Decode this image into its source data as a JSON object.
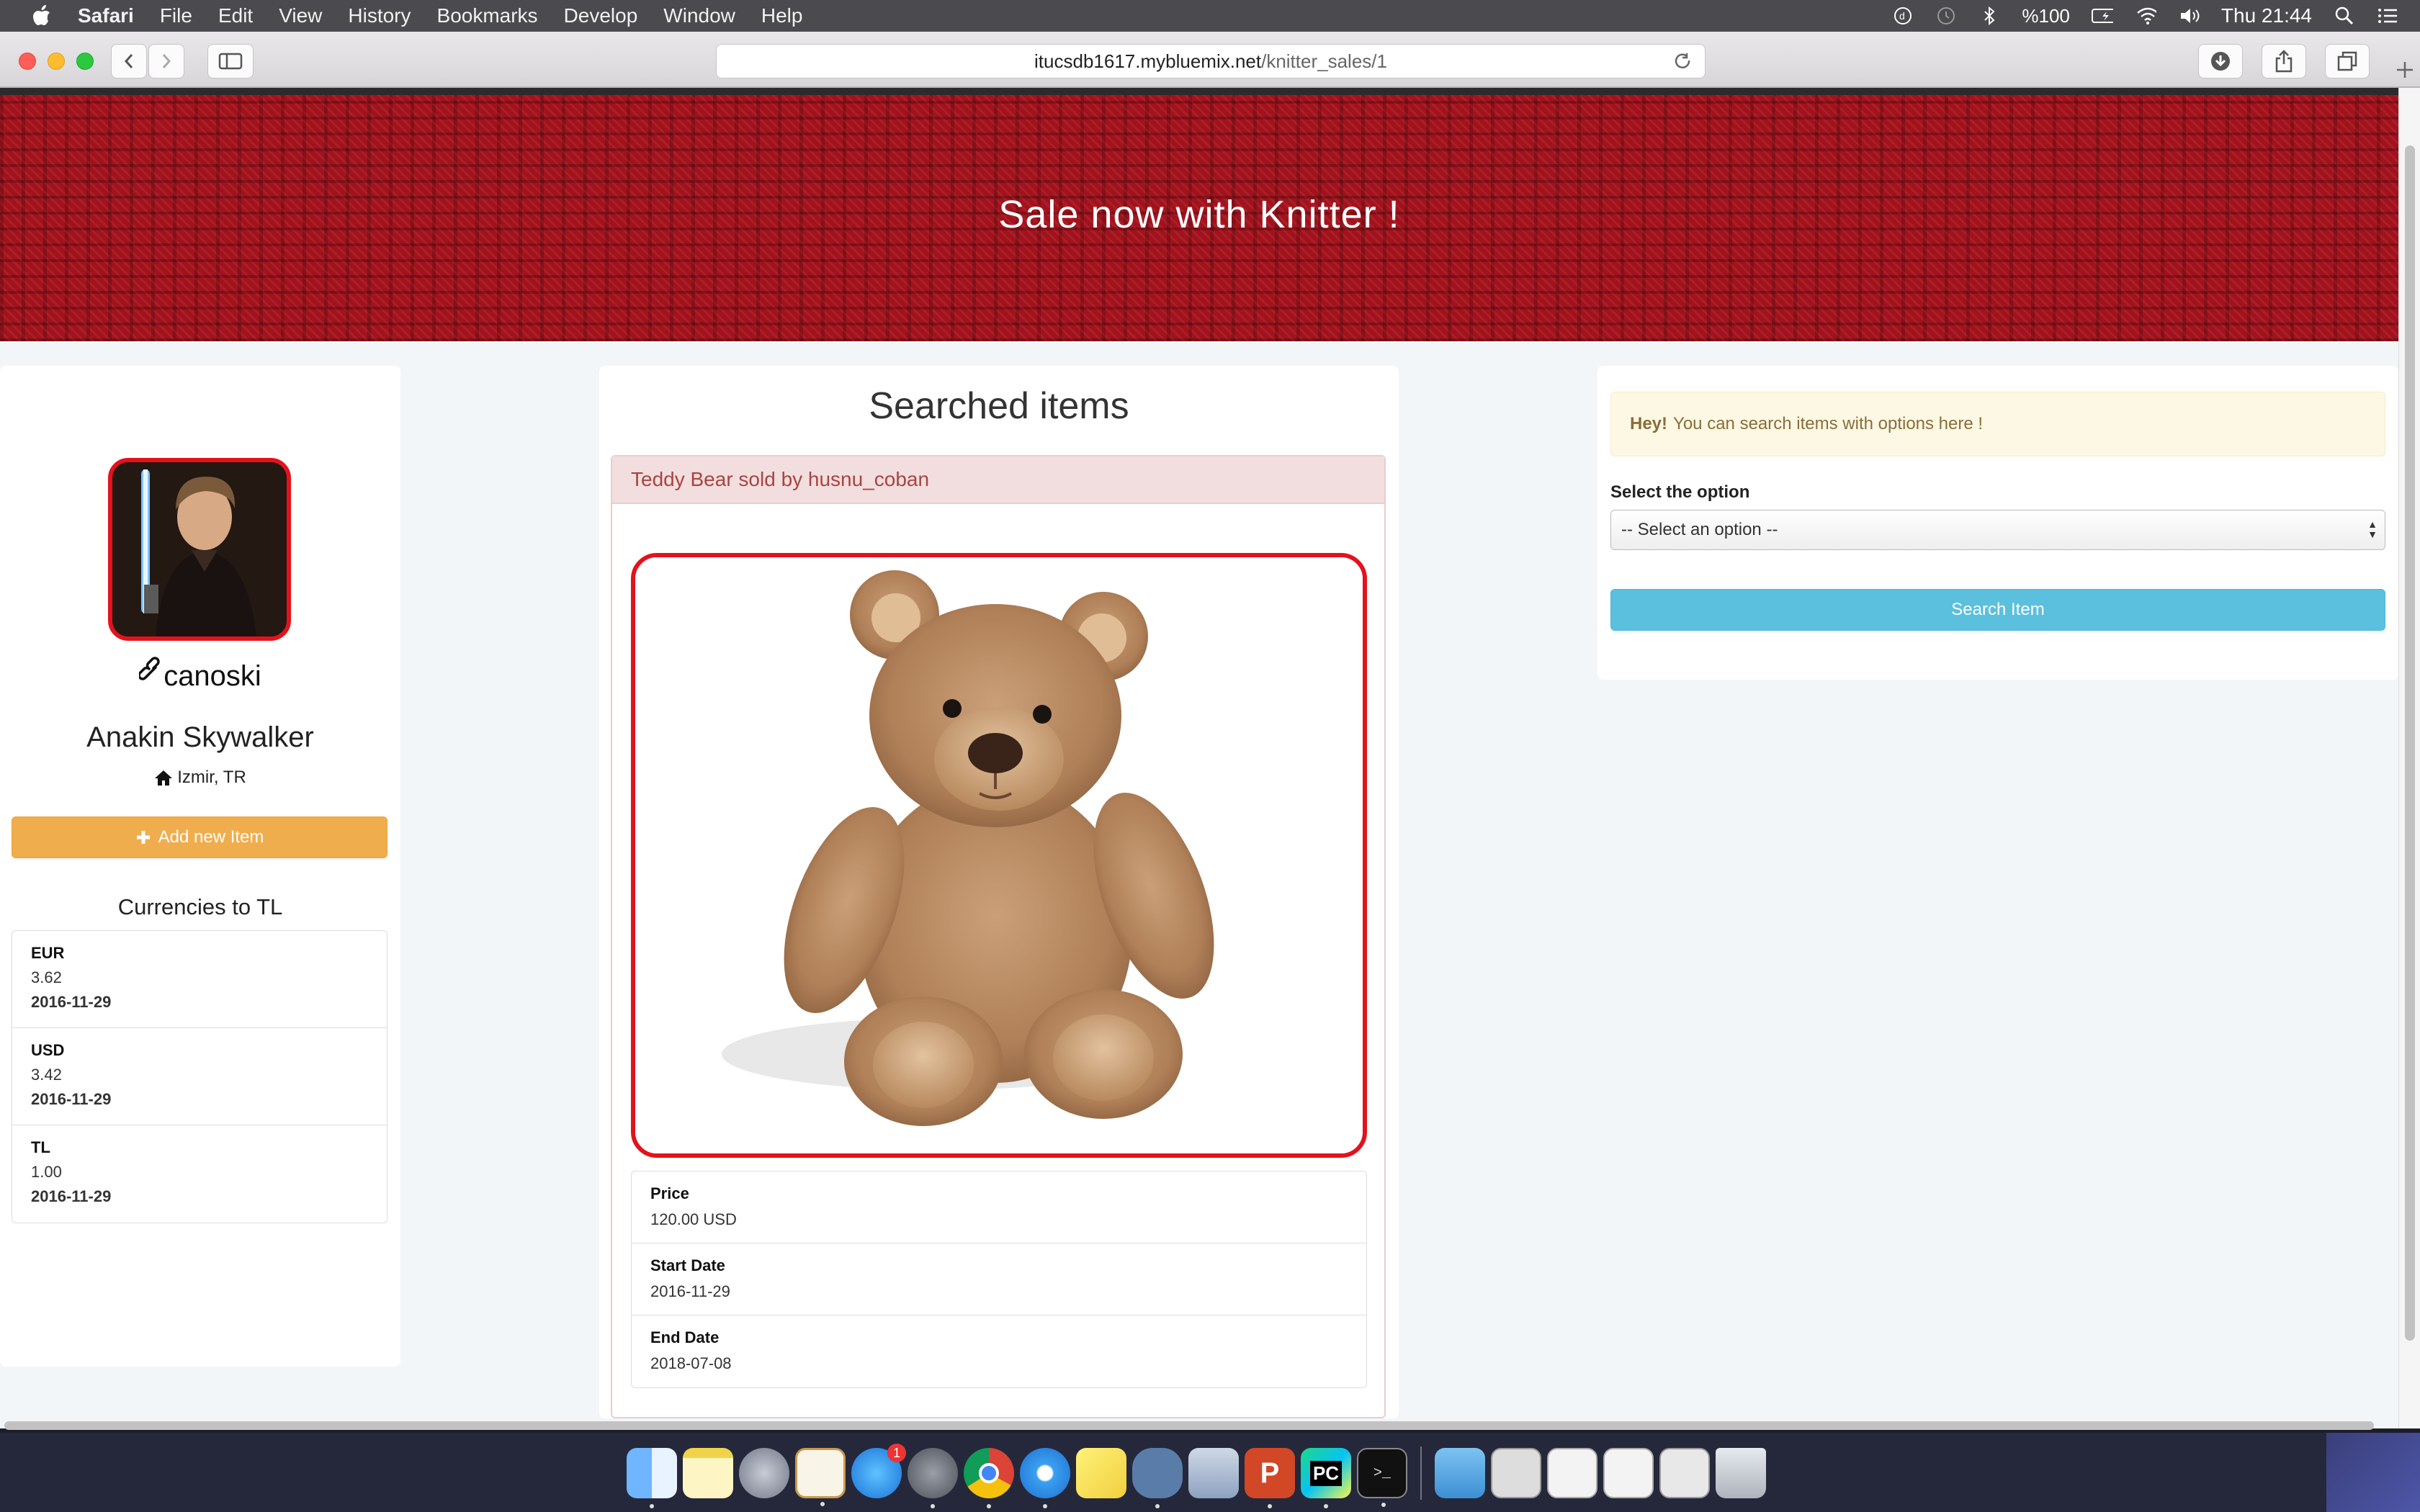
{
  "menubar": {
    "app_name": "Safari",
    "items": [
      "File",
      "Edit",
      "View",
      "History",
      "Bookmarks",
      "Develop",
      "Window",
      "Help"
    ],
    "battery": "%100",
    "clock": "Thu 21:44"
  },
  "browser": {
    "url_host": "itucsdb1617.mybluemix.net",
    "url_path": "/knitter_sales/1"
  },
  "banner": {
    "title": "Sale now with Knitter !"
  },
  "profile": {
    "username": "canoski",
    "full_name": "Anakin Skywalker",
    "location": "Izmir, TR",
    "add_button": "Add new Item",
    "currencies_title": "Currencies to TL",
    "currencies": [
      {
        "code": "EUR",
        "value": "3.62",
        "date": "2016-11-29"
      },
      {
        "code": "USD",
        "value": "3.42",
        "date": "2016-11-29"
      },
      {
        "code": "TL",
        "value": "1.00",
        "date": "2016-11-29"
      }
    ]
  },
  "results": {
    "heading": "Searched items",
    "item_title": "Teddy Bear sold by husnu_coban",
    "details": [
      {
        "label": "Price",
        "value": "120.00 USD"
      },
      {
        "label": "Start Date",
        "value": "2016-11-29"
      },
      {
        "label": "End Date",
        "value": "2018-07-08"
      }
    ]
  },
  "search": {
    "alert_strong": "Hey!",
    "alert_text": "You can search items with options here !",
    "select_label": "Select the option",
    "select_value": "-- Select an option --",
    "button": "Search Item"
  },
  "colors": {
    "banner": "#a3121c",
    "avatar_border": "#e4121d",
    "add_button": "#f0ad4e",
    "search_button": "#5bc0de",
    "alert_bg": "#fcf8e3",
    "item_header_bg": "#f2dede"
  },
  "dock": {
    "apps": [
      "finder-icon",
      "notes-icon",
      "launchpad-icon",
      "textedit-icon",
      "app-store-icon",
      "system-preferences-icon",
      "chrome-icon",
      "safari-icon",
      "stickies-icon",
      "postgres-icon",
      "preview-icon",
      "powerpoint-icon",
      "pycharm-icon",
      "terminal-icon",
      "downloads-folder-icon",
      "window-thumb-1-icon",
      "window-thumb-2-icon",
      "window-thumb-3-icon",
      "window-thumb-4-icon",
      "trash-icon"
    ],
    "app_store_badge": "1"
  }
}
